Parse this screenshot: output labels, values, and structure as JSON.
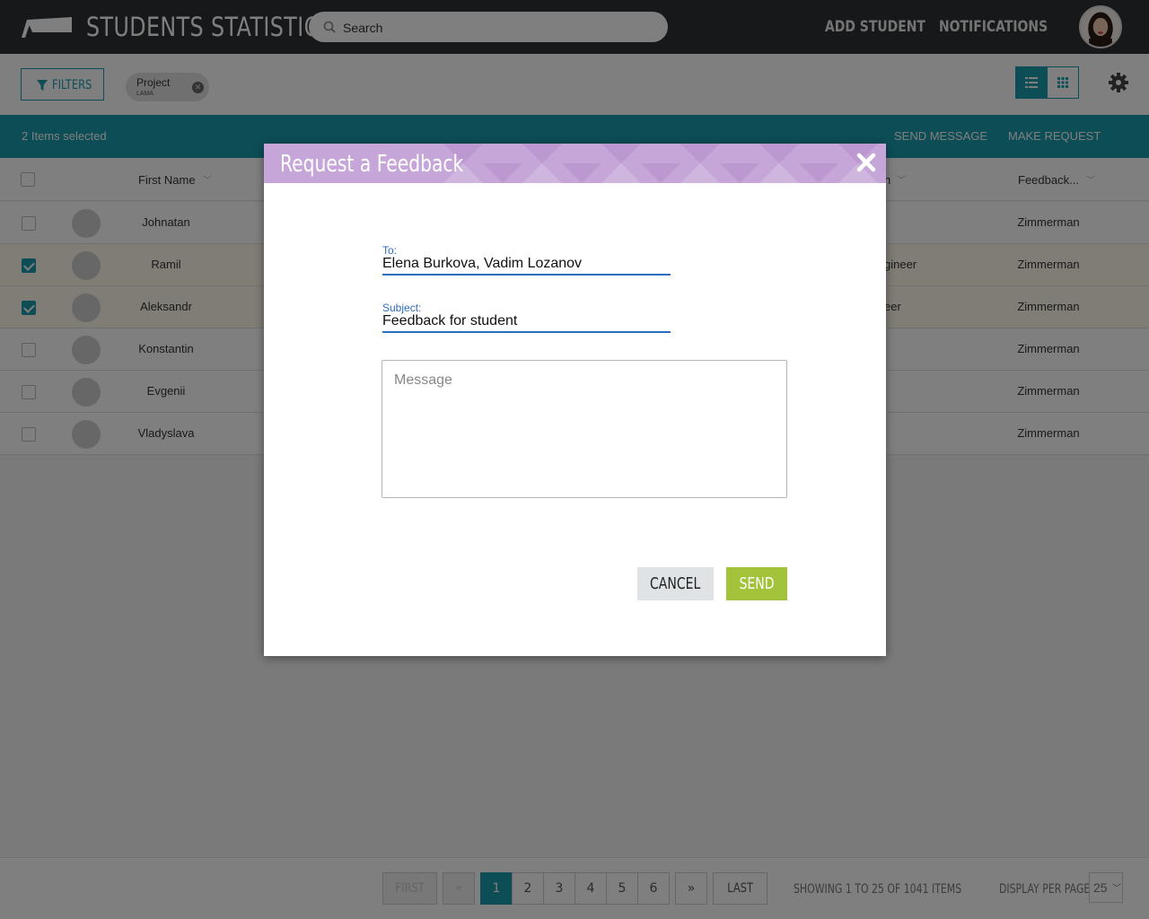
{
  "header": {
    "title": "STUDENTS STATISTICS",
    "search_placeholder": "Search",
    "nav": [
      "ADD STUDENT",
      "NOTIFICATIONS"
    ],
    "icons": {
      "logo": "graduation-cap-icon",
      "search": "search-icon",
      "avatar": "user-avatar"
    }
  },
  "filter_bar": {
    "filters_label": "FILTERS",
    "chip": {
      "label": "Project",
      "value": "LAMA"
    },
    "icons": [
      "filter-icon",
      "list-view-icon",
      "grid-view-icon",
      "gear-icon"
    ]
  },
  "action_bar": {
    "selected_text": "2 Items selected",
    "actions": [
      "SEND MESSAGE",
      "MAKE REQUEST"
    ]
  },
  "table": {
    "headers": {
      "first_name": "First Name",
      "position": "n",
      "feedback": "Feedback..."
    },
    "rows": [
      {
        "first_name": "Johnatan",
        "position": "",
        "feedback": "Zimmerman",
        "selected": false
      },
      {
        "first_name": "Ramil",
        "position": "gineer",
        "feedback": "Zimmerman",
        "selected": true
      },
      {
        "first_name": "Aleksandr",
        "position": "eer",
        "feedback": "Zimmerman",
        "selected": true
      },
      {
        "first_name": "Konstantin",
        "position": "",
        "feedback": "Zimmerman",
        "selected": false
      },
      {
        "first_name": "Evgenii",
        "position": "",
        "feedback": "Zimmerman",
        "selected": false
      },
      {
        "first_name": "Vladyslava",
        "position": "",
        "feedback": "Zimmerman",
        "selected": false
      }
    ]
  },
  "pagination": {
    "first": "FIRST",
    "prev": "«",
    "pages": [
      "1",
      "2",
      "3",
      "4",
      "5",
      "6"
    ],
    "current": "1",
    "next": "»",
    "last": "LAST",
    "info": "SHOWING 1 TO 25 OF 1041 ITEMS",
    "per_page_label": "DISPLAY PER PAGE",
    "per_page_value": "25"
  },
  "modal": {
    "title": "Request a Feedback",
    "to_label": "To:",
    "to_value": "Elena Burkova, Vadim Lozanov",
    "subject_label": "Subject:",
    "subject_value": "Feedback for student",
    "message_placeholder": "Message",
    "cancel_label": "CANCEL",
    "send_label": "SEND",
    "colors": {
      "header": "#c6a6d8",
      "send": "#a2c33a",
      "accent": "#1a9aac",
      "field_line": "#2d6cc0"
    }
  }
}
